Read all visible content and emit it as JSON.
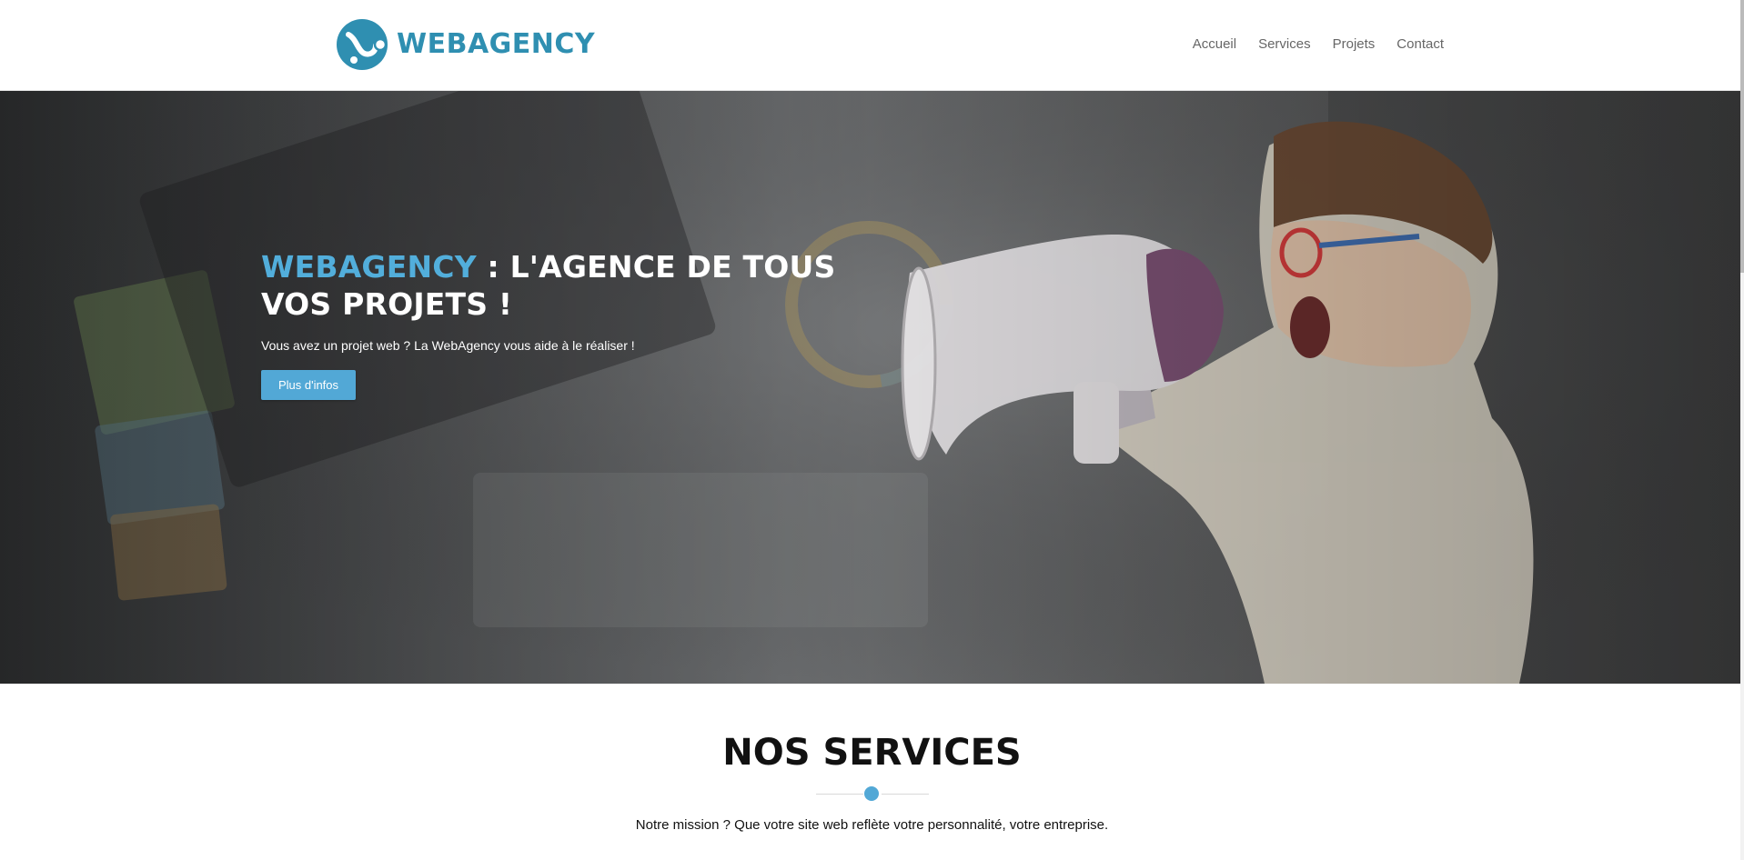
{
  "header": {
    "logo_text": "WEBAGENCY",
    "nav": [
      {
        "label": "Accueil"
      },
      {
        "label": "Services"
      },
      {
        "label": "Projets"
      },
      {
        "label": "Contact"
      }
    ]
  },
  "hero": {
    "title_accent": "WEBAGENCY",
    "title_rest": " : L'AGENCE DE TOUS VOS PROJETS !",
    "subtitle": "Vous avez un projet web ? La WebAgency vous aide à le réaliser !",
    "button_label": "Plus d'infos",
    "image_icon": "kid-megaphone-photo"
  },
  "services": {
    "title": "NOS SERVICES",
    "subtitle": "Notre mission ? Que votre site web reflète votre personnalité, votre entreprise."
  },
  "colors": {
    "brand": "#2f8fb1",
    "accent": "#52a8d6",
    "nav_text": "#666666"
  }
}
